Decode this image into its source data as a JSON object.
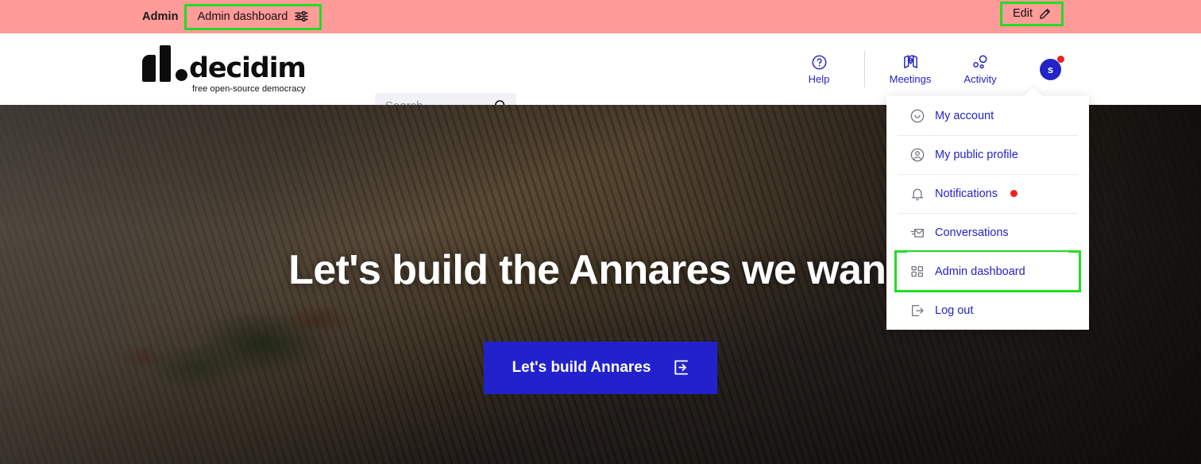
{
  "admin_bar": {
    "label": "Admin",
    "dashboard_button": "Admin dashboard",
    "dashboard_icon": "sliders-icon",
    "edit_button": "Edit",
    "edit_icon": "pencil-icon",
    "background_color": "#ff9b99",
    "highlight_color": "#22dd22"
  },
  "header": {
    "logo": {
      "word": "decidim",
      "tagline": "free open-source democracy"
    },
    "search": {
      "placeholder": "Search",
      "value": "",
      "icon": "search-icon"
    },
    "nav": [
      {
        "label": "Help",
        "icon": "question-circle-icon"
      },
      {
        "label": "Meetings",
        "icon": "map-pin-icon"
      },
      {
        "label": "Activity",
        "icon": "bubbles-icon"
      }
    ],
    "avatar": {
      "initial": "s",
      "has_notification_dot": true,
      "color": "#2323c8",
      "dot_color": "#ee2222"
    }
  },
  "user_menu": {
    "items": [
      {
        "label": "My account",
        "icon": "smiley-circle-icon",
        "badge": false,
        "highlighted": false
      },
      {
        "label": "My public profile",
        "icon": "person-circle-icon",
        "badge": false,
        "highlighted": false
      },
      {
        "label": "Notifications",
        "icon": "bell-icon",
        "badge": true,
        "highlighted": false
      },
      {
        "label": "Conversations",
        "icon": "mail-send-icon",
        "badge": false,
        "highlighted": false
      },
      {
        "label": "Admin dashboard",
        "icon": "grid-dashboard-icon",
        "badge": false,
        "highlighted": true
      },
      {
        "label": "Log out",
        "icon": "logout-icon",
        "badge": false,
        "highlighted": false
      }
    ]
  },
  "hero": {
    "title": "Let's build the Annares we want!",
    "cta_label": "Let's build Annares",
    "cta_icon": "login-box-icon",
    "cta_color": "#2222cc",
    "background": "aerial photo of a canyon valley with sandy cliffs and a village"
  }
}
